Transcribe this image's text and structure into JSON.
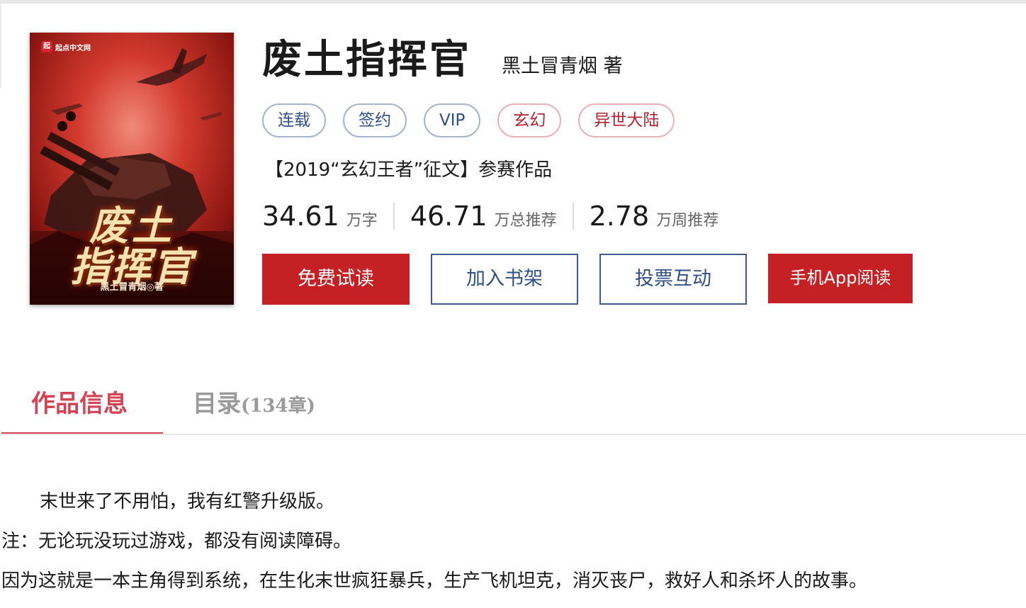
{
  "cover": {
    "logo_text": "起点中文网",
    "title_line1": "废土",
    "title_line2": "指挥官",
    "author": "黑土冒青烟◎著"
  },
  "book": {
    "title": "废土指挥官",
    "author_line": "黑土冒青烟 著",
    "tags": [
      {
        "label": "连载",
        "style": "blue"
      },
      {
        "label": "签约",
        "style": "blue"
      },
      {
        "label": "VIP",
        "style": "blue"
      },
      {
        "label": "玄幻",
        "style": "red"
      },
      {
        "label": "异世大陆",
        "style": "red"
      }
    ],
    "contest": "【2019“玄幻王者”征文】参赛作品",
    "stats": [
      {
        "value": "34.61",
        "unit": "万字"
      },
      {
        "value": "46.71",
        "unit": "万总推荐"
      },
      {
        "value": "2.78",
        "unit": "万周推荐"
      }
    ]
  },
  "actions": {
    "free_read": "免费试读",
    "add_shelf": "加入书架",
    "vote": "投票互动",
    "app_read": "手机App阅读"
  },
  "tabs": {
    "info_label": "作品信息",
    "catalog_label": "目录",
    "catalog_count": "(134章)"
  },
  "intro": {
    "lines": [
      "末世来了不用怕，我有红警升级版。",
      "注：无论玩没玩过游戏，都没有阅读障碍。",
      "因为这就是一本主角得到系统，在生化末世疯狂暴兵，生产飞机坦克，消灭丧尸，救好人和杀坏人的故事。"
    ]
  },
  "colors": {
    "brand_red": "#c52024",
    "tag_blue": "#2f4f86",
    "tag_red": "#b0232f",
    "tab_active": "#d44354"
  }
}
